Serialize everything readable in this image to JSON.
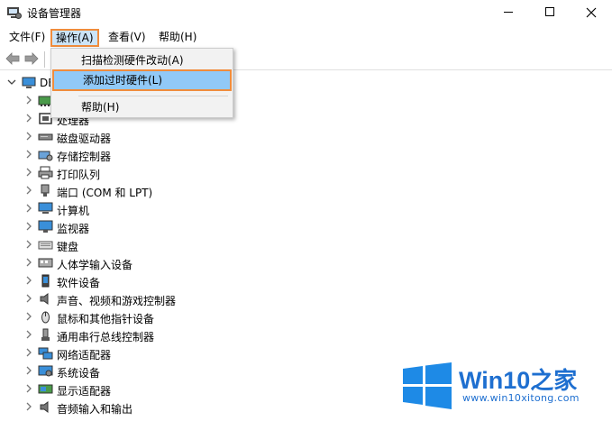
{
  "window": {
    "title": "设备管理器",
    "minimize": "—",
    "maximize": "☐",
    "close": "✕"
  },
  "menubar": {
    "items": [
      {
        "label": "文件(F)"
      },
      {
        "label": "操作(A)"
      },
      {
        "label": "查看(V)"
      },
      {
        "label": "帮助(H)"
      }
    ]
  },
  "dropdown": {
    "items": [
      {
        "label": "扫描检测硬件改动(A)"
      },
      {
        "label": "添加过时硬件(L)"
      },
      {
        "label": "帮助(H)"
      }
    ]
  },
  "tree": {
    "root": {
      "label": "DE"
    },
    "nodes": [
      {
        "label": "",
        "icon": "network-card-icon"
      },
      {
        "label": "处理器",
        "icon": "processor-icon"
      },
      {
        "label": "磁盘驱动器",
        "icon": "disk-drive-icon"
      },
      {
        "label": "存储控制器",
        "icon": "storage-controller-icon"
      },
      {
        "label": "打印队列",
        "icon": "printer-icon"
      },
      {
        "label": "端口 (COM 和 LPT)",
        "icon": "port-icon"
      },
      {
        "label": "计算机",
        "icon": "computer-icon"
      },
      {
        "label": "监视器",
        "icon": "monitor-icon"
      },
      {
        "label": "键盘",
        "icon": "keyboard-icon"
      },
      {
        "label": "人体学输入设备",
        "icon": "hid-icon"
      },
      {
        "label": "软件设备",
        "icon": "software-device-icon"
      },
      {
        "label": "声音、视频和游戏控制器",
        "icon": "speaker-icon"
      },
      {
        "label": "鼠标和其他指针设备",
        "icon": "mouse-icon"
      },
      {
        "label": "通用串行总线控制器",
        "icon": "usb-icon"
      },
      {
        "label": "网络适配器",
        "icon": "network-adapter-icon"
      },
      {
        "label": "系统设备",
        "icon": "system-device-icon"
      },
      {
        "label": "显示适配器",
        "icon": "display-adapter-icon"
      },
      {
        "label": "音频输入和输出",
        "icon": "audio-io-icon"
      }
    ]
  },
  "watermark": {
    "brand": "Win10",
    "brand_zh": "之家",
    "url": "www.win10xitong.com"
  },
  "colors": {
    "highlight_border": "#f08c3c",
    "selected_bg": "#91c9f7",
    "menu_active_bg": "#cce4f7",
    "brand_blue": "#1e6fd0"
  }
}
